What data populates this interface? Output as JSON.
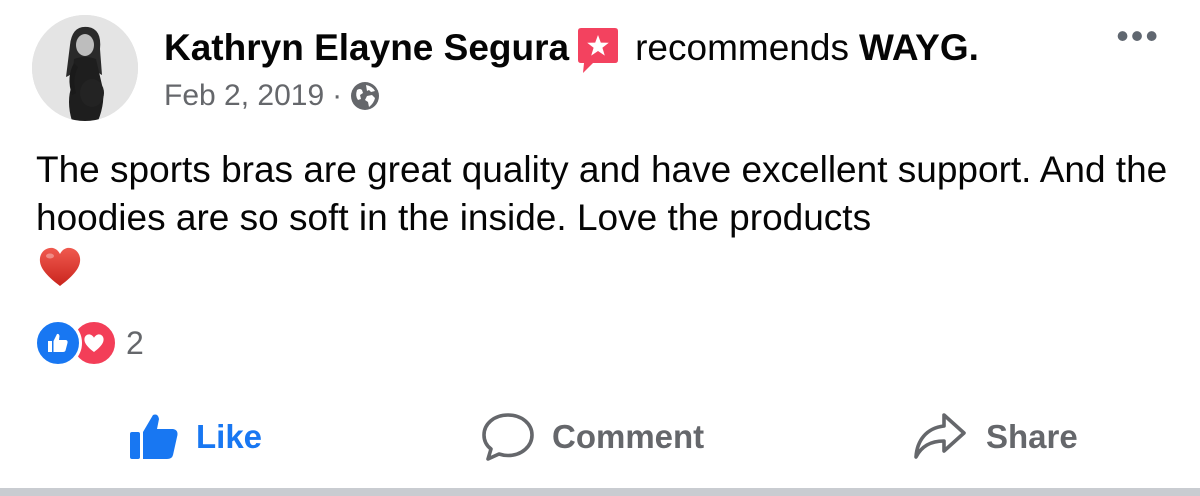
{
  "post": {
    "author": "Kathryn Elayne Segura",
    "recommends_text": "recommends",
    "page_name": "WAYG.",
    "date": "Feb 2, 2019",
    "meta_separator": "·",
    "privacy_icon": "globe-icon",
    "more_menu_label": "•••",
    "text": "The sports bras are great quality and have excellent support. And the hoodies are so soft in the inside. Love the products",
    "emoji": "red-heart-emoji"
  },
  "reactions": {
    "types": [
      "like",
      "love"
    ],
    "count": "2"
  },
  "actions": {
    "like_label": "Like",
    "comment_label": "Comment",
    "share_label": "Share"
  },
  "colors": {
    "accent_blue": "#1877f2",
    "recommend_red": "#f3425f",
    "love_red": "#f33e58",
    "secondary_text": "#65676b",
    "primary_text": "#050505"
  }
}
